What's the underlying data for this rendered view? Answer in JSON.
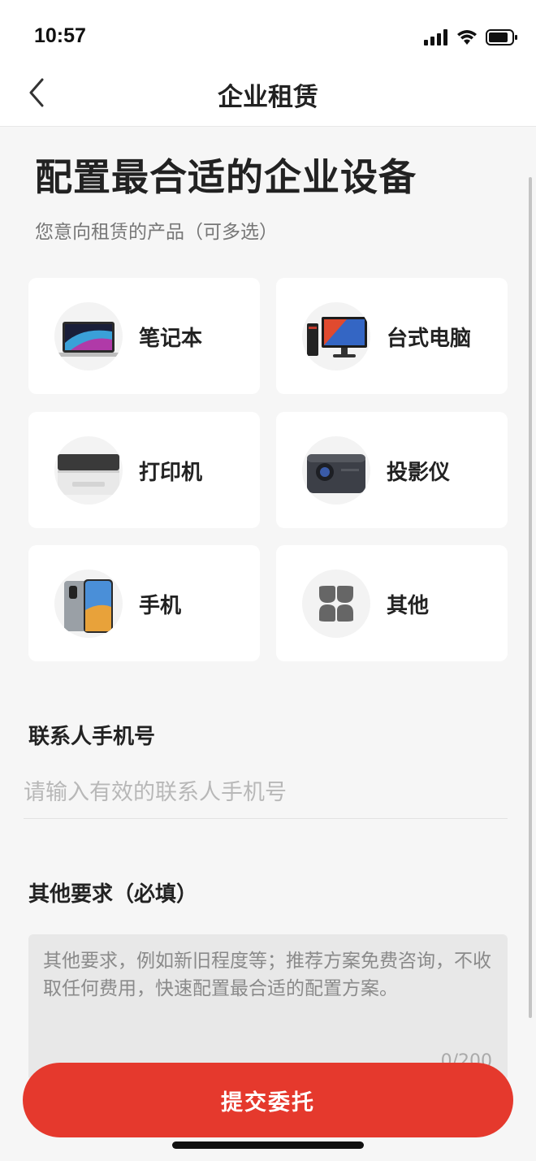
{
  "status_bar": {
    "time": "10:57"
  },
  "nav": {
    "title": "企业租赁",
    "back_icon": "chevron-left-icon"
  },
  "headline": "配置最合适的企业设备",
  "subhead": "您意向租赁的产品（可多选）",
  "products": [
    {
      "label": "笔记本",
      "icon": "laptop-icon"
    },
    {
      "label": "台式电脑",
      "icon": "desktop-computer-icon"
    },
    {
      "label": "打印机",
      "icon": "printer-icon"
    },
    {
      "label": "投影仪",
      "icon": "projector-icon"
    },
    {
      "label": "手机",
      "icon": "phone-icon"
    },
    {
      "label": "其他",
      "icon": "four-dots-icon"
    }
  ],
  "contact": {
    "label": "联系人手机号",
    "placeholder": "请输入有效的联系人手机号",
    "value": ""
  },
  "requirements": {
    "label": "其他要求（必填）",
    "placeholder": "其他要求，例如新旧程度等；推荐方案免费咨询，不收取任何费用，快速配置最合适的配置方案。",
    "value": "",
    "counter": "0/200"
  },
  "submit_label": "提交委托",
  "colors": {
    "accent": "#e5392d",
    "background": "#f6f6f6",
    "card": "#ffffff"
  }
}
